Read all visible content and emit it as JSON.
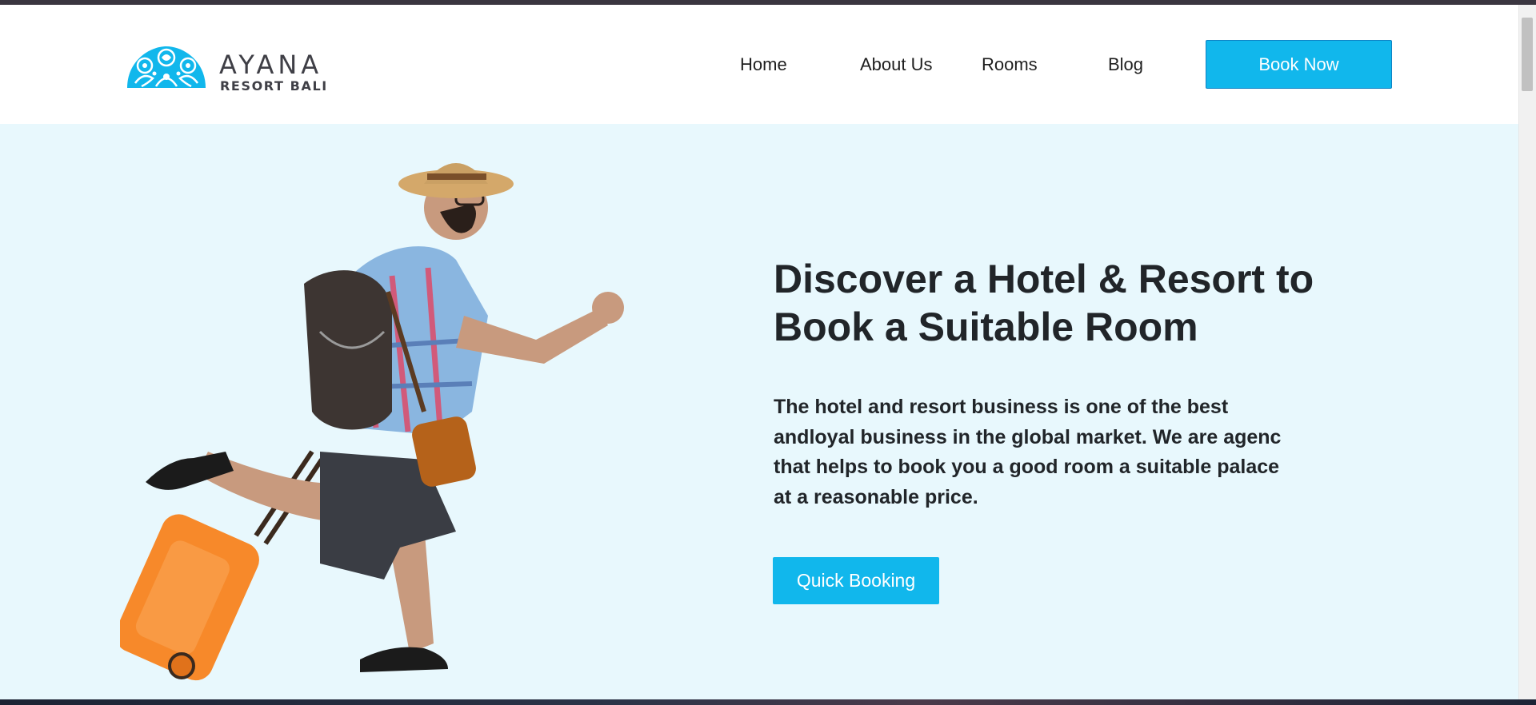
{
  "brand": {
    "name": "AYANA",
    "subtitle": "RESORT BALI",
    "accent_color": "#11b7ec"
  },
  "nav": {
    "items": [
      {
        "label": "Home"
      },
      {
        "label": "About Us"
      },
      {
        "label": "Rooms"
      },
      {
        "label": "Blog"
      }
    ],
    "cta_label": "Book Now"
  },
  "hero": {
    "title": "Discover a Hotel & Resort to Book a Suitable Room",
    "description": "The hotel and resort business is one of the best andloyal business in the global market. We are agenc that helps to book you a good room a suitable palace at a reasonable price.",
    "cta_label": "Quick Booking",
    "background_color": "#e8f8fd",
    "image": "traveler-running-with-suitcase"
  }
}
